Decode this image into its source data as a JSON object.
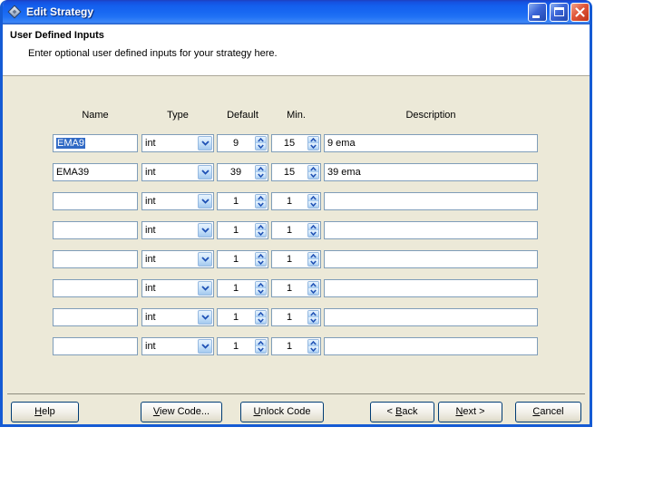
{
  "window": {
    "title": "Edit Strategy"
  },
  "header": {
    "title": "User Defined Inputs",
    "subtitle": "Enter optional user defined inputs for your strategy here."
  },
  "columns": [
    "Name",
    "Type",
    "Default",
    "Min.",
    "Description"
  ],
  "rows": [
    {
      "name": "EMA9",
      "type": "int",
      "default": "9",
      "min": "15",
      "description": "9 ema",
      "name_selected": true
    },
    {
      "name": "EMA39",
      "type": "int",
      "default": "39",
      "min": "15",
      "description": "39 ema",
      "name_selected": false
    },
    {
      "name": "",
      "type": "int",
      "default": "1",
      "min": "1",
      "description": "",
      "name_selected": false
    },
    {
      "name": "",
      "type": "int",
      "default": "1",
      "min": "1",
      "description": "",
      "name_selected": false
    },
    {
      "name": "",
      "type": "int",
      "default": "1",
      "min": "1",
      "description": "",
      "name_selected": false
    },
    {
      "name": "",
      "type": "int",
      "default": "1",
      "min": "1",
      "description": "",
      "name_selected": false
    },
    {
      "name": "",
      "type": "int",
      "default": "1",
      "min": "1",
      "description": "",
      "name_selected": false
    },
    {
      "name": "",
      "type": "int",
      "default": "1",
      "min": "1",
      "description": "",
      "name_selected": false
    }
  ],
  "buttons": {
    "help": {
      "pre": "",
      "key": "H",
      "post": "elp"
    },
    "view_code": {
      "pre": "",
      "key": "V",
      "post": "iew Code..."
    },
    "unlock_code": {
      "pre": "",
      "key": "U",
      "post": "nlock Code"
    },
    "back": {
      "pre": "< ",
      "key": "B",
      "post": "ack"
    },
    "next": {
      "pre": "",
      "key": "N",
      "post": "ext >"
    },
    "cancel": {
      "pre": "",
      "key": "C",
      "post": "ancel"
    }
  },
  "colors": {
    "titlebar_blue": "#1868F2",
    "window_border": "#155BD4",
    "content_bg": "#ECE9D8",
    "selection_blue": "#316AC5",
    "input_border": "#7F9DB9",
    "button_border": "#003C74",
    "close_button_red": "#D6492A"
  }
}
